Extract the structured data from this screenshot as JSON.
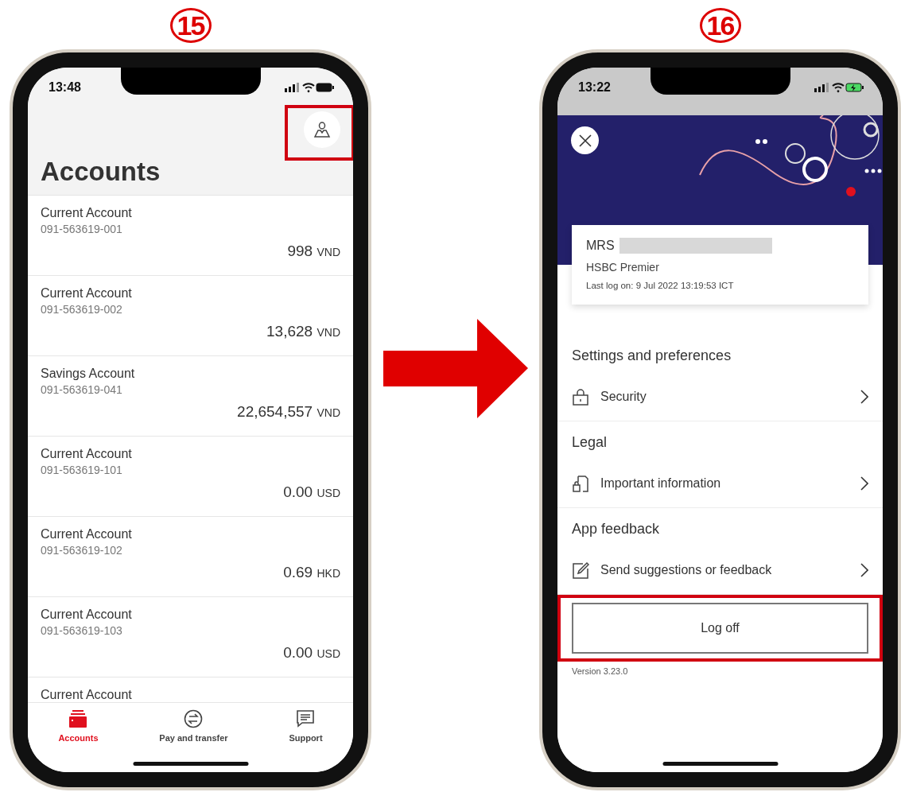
{
  "steps": [
    {
      "label": "15"
    },
    {
      "label": "16"
    }
  ],
  "accounts_screen": {
    "time": "13:48",
    "title": "Accounts",
    "profile_highlighted": true,
    "accounts": [
      {
        "name": "Current Account",
        "number": "091-563619-001",
        "amount": "998",
        "currency": "VND"
      },
      {
        "name": "Current Account",
        "number": "091-563619-002",
        "amount": "13,628",
        "currency": "VND"
      },
      {
        "name": "Savings Account",
        "number": "091-563619-041",
        "amount": "22,654,557",
        "currency": "VND"
      },
      {
        "name": "Current Account",
        "number": "091-563619-101",
        "amount": "0.00",
        "currency": "USD"
      },
      {
        "name": "Current Account",
        "number": "091-563619-102",
        "amount": "0.69",
        "currency": "HKD"
      },
      {
        "name": "Current Account",
        "number": "091-563619-103",
        "amount": "0.00",
        "currency": "USD"
      },
      {
        "name": "Current Account"
      }
    ],
    "tabs": [
      {
        "label": "Accounts",
        "kind": "wallet",
        "selected": true
      },
      {
        "label": "Pay and transfer",
        "kind": "transfer",
        "selected": false
      },
      {
        "label": "Support",
        "kind": "chat",
        "selected": false
      }
    ]
  },
  "profile_screen": {
    "time": "13:22",
    "card": {
      "title": "MRS",
      "tier": "HSBC Premier",
      "last_log_on": "Last log on: 9 Jul 2022 13:19:53 ICT"
    },
    "sections": [
      {
        "heading": "Settings and preferences",
        "items": [
          {
            "label": "Security",
            "kind": "lock"
          }
        ]
      },
      {
        "heading": "Legal",
        "items": [
          {
            "label": "Important information",
            "kind": "document"
          }
        ]
      },
      {
        "heading": "App feedback",
        "items": [
          {
            "label": "Send suggestions or feedback",
            "kind": "edit"
          }
        ]
      }
    ],
    "log_off": {
      "label": "Log off",
      "highlighted": true
    },
    "version": "Version 3.23.0"
  }
}
